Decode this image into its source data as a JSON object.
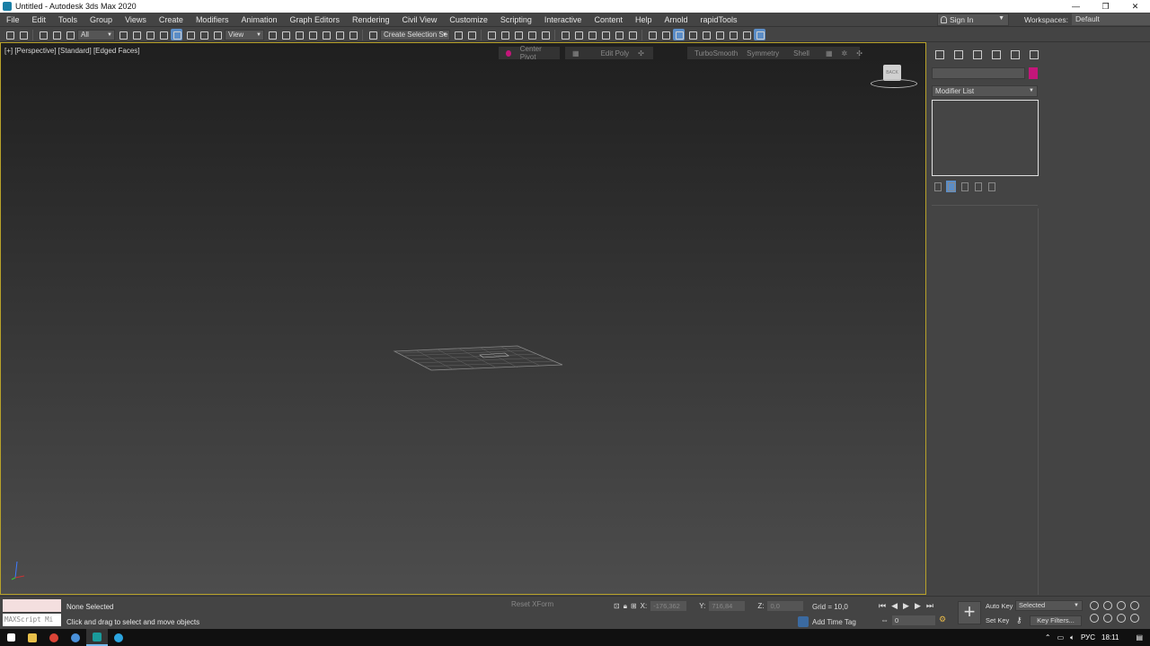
{
  "window": {
    "title": "Untitled - Autodesk 3ds Max 2020",
    "controls": [
      "—",
      "❐",
      "✕"
    ]
  },
  "menu": [
    "File",
    "Edit",
    "Tools",
    "Group",
    "Views",
    "Create",
    "Modifiers",
    "Animation",
    "Graph Editors",
    "Rendering",
    "Civil View",
    "Customize",
    "Scripting",
    "Interactive",
    "Content",
    "Help",
    "Arnold",
    "rapidTools"
  ],
  "account": {
    "signin_label": "Sign In",
    "workspaces_label": "Workspaces:",
    "workspace_value": "Default"
  },
  "toolbar": {
    "filter_value": "All",
    "refcoord_value": "View",
    "selection_set_value": "Create Selection Se"
  },
  "viewport": {
    "label": "[+] [Perspective] [Standard] [Edged Faces]",
    "ribbon_center_pivot": "Center Pivot",
    "ribbon_edit_poly": "Edit Poly",
    "ribbon_turbosmooth": "TurboSmooth",
    "ribbon_symmetry": "Symmetry",
    "ribbon_shell": "Shell",
    "viewcube_face": "BACK"
  },
  "command_panel": {
    "modifier_list": "Modifier List",
    "object_color": "#c4167a"
  },
  "status": {
    "selection": "None Selected",
    "prompt": "Click and drag to select and move objects",
    "maxscript_placeholder": "MAXScript Mi",
    "reset_xform": "Reset XForm",
    "x_label": "X:",
    "x_value": "-176,362",
    "y_label": "Y:",
    "y_value": "716,84",
    "z_label": "Z:",
    "z_value": "0,0",
    "grid": "Grid = 10,0",
    "add_time_tag": "Add Time Tag",
    "frame_value": "0",
    "auto_key": "Auto Key",
    "set_key": "Set Key",
    "selected_value": "Selected",
    "key_filters": "Key Filters..."
  },
  "taskbar": {
    "language": "РУС",
    "time": "18:11"
  }
}
